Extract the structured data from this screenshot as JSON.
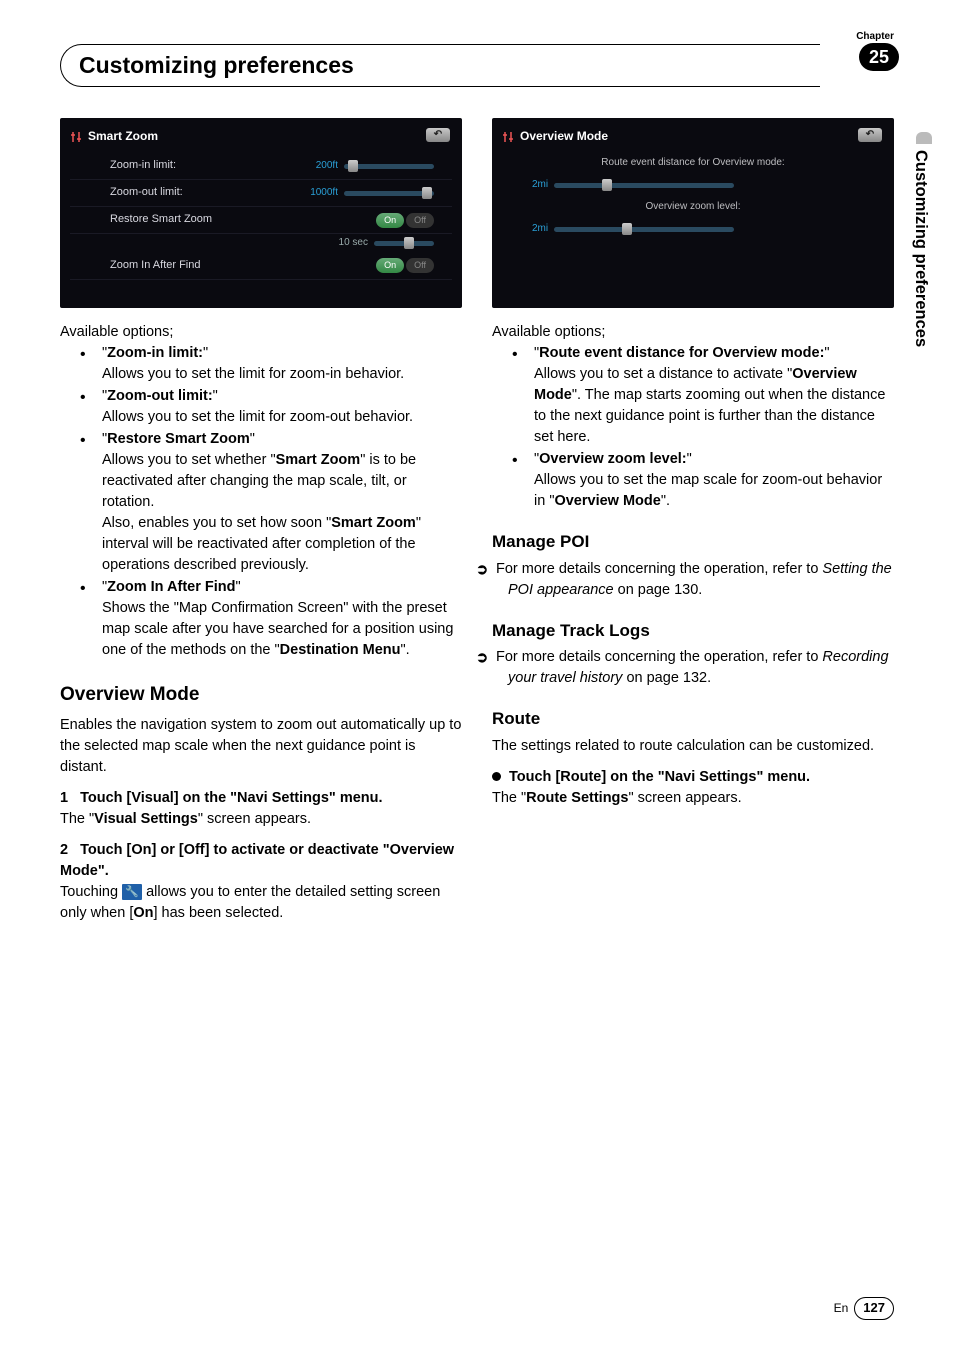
{
  "header": {
    "chapter_label": "Chapter",
    "chapter_number": "25",
    "title": "Customizing preferences",
    "side_tab": "Customizing preferences"
  },
  "col1": {
    "screenshot": {
      "title": "Smart Zoom",
      "rows": {
        "zoom_in_label": "Zoom-in limit:",
        "zoom_in_val": "200ft",
        "zoom_out_label": "Zoom-out limit:",
        "zoom_out_val": "1000ft",
        "restore_label": "Restore Smart Zoom",
        "restore_on": "On",
        "restore_off": "Off",
        "interval_val": "10 sec",
        "after_find_label": "Zoom In After Find",
        "after_find_on": "On",
        "after_find_off": "Off"
      }
    },
    "intro": "Available options;",
    "opt1": {
      "label": "Zoom-in limit:",
      "desc": "Allows you to set the limit for zoom-in behavior."
    },
    "opt2": {
      "label": "Zoom-out limit:",
      "desc": "Allows you to set the limit for zoom-out behavior."
    },
    "opt3": {
      "label": "Restore Smart Zoom",
      "desc1a": "Allows you to set whether \"",
      "desc1b": "Smart Zoom",
      "desc1c": "\" is to be reactivated after changing the map scale, tilt, or rotation.",
      "desc2a": "Also, enables you to set how soon \"",
      "desc2b": "Smart Zoom",
      "desc2c": "\" interval will be reactivated after completion of the operations described previously."
    },
    "opt4": {
      "label": "Zoom In After Find",
      "desc_a": "Shows the \"Map Confirmation Screen\" with the preset map scale after you have searched for a position using one of the methods on the \"",
      "desc_b": "Destination Menu",
      "desc_c": "\"."
    },
    "overview": {
      "heading": "Overview Mode",
      "intro": "Enables the navigation system to zoom out automatically up to the selected map scale when the next guidance point is distant.",
      "step1_num": "1",
      "step1_label": "Touch [Visual] on the \"Navi Settings\" menu.",
      "step1_result_a": "The \"",
      "step1_result_b": "Visual Settings",
      "step1_result_c": "\" screen appears.",
      "step2_num": "2",
      "step2_label": "Touch [On] or [Off] to activate or deactivate \"Overview Mode\".",
      "step2_a": "Touching ",
      "step2_b": " allows you to enter the detailed setting screen only when [",
      "step2_c": "On",
      "step2_d": "] has been selected."
    }
  },
  "col2": {
    "screenshot": {
      "title": "Overview Mode",
      "row1_label": "Route event distance for Overview mode:",
      "row1_val": "2mi",
      "row2_label": "Overview zoom level:",
      "row2_val": "2mi"
    },
    "intro": "Available options;",
    "opt1": {
      "label": "Route event distance for Overview mode:",
      "desc_a": "Allows you to set a distance to activate \"",
      "desc_b": "Overview Mode",
      "desc_c": "\". The map starts zooming out when the distance to the next guidance point is further than the distance set here."
    },
    "opt2": {
      "label": "Overview zoom level:",
      "desc_a": "Allows you to set the map scale for zoom-out behavior in \"",
      "desc_b": "Overview Mode",
      "desc_c": "\"."
    },
    "poi": {
      "heading": "Manage POI",
      "ref_a": "For more details concerning the operation, refer to ",
      "ref_b": "Setting the POI appearance",
      "ref_c": " on page 130."
    },
    "tracklogs": {
      "heading": "Manage Track Logs",
      "ref_a": "For more details concerning the operation, refer to ",
      "ref_b": "Recording your travel history",
      "ref_c": " on page 132."
    },
    "route": {
      "heading": "Route",
      "intro": "The settings related to route calculation can be customized.",
      "step_label": "Touch [Route] on the \"Navi Settings\" menu.",
      "result_a": "The \"",
      "result_b": "Route Settings",
      "result_c": "\" screen appears."
    }
  },
  "footer": {
    "lang": "En",
    "page": "127"
  }
}
